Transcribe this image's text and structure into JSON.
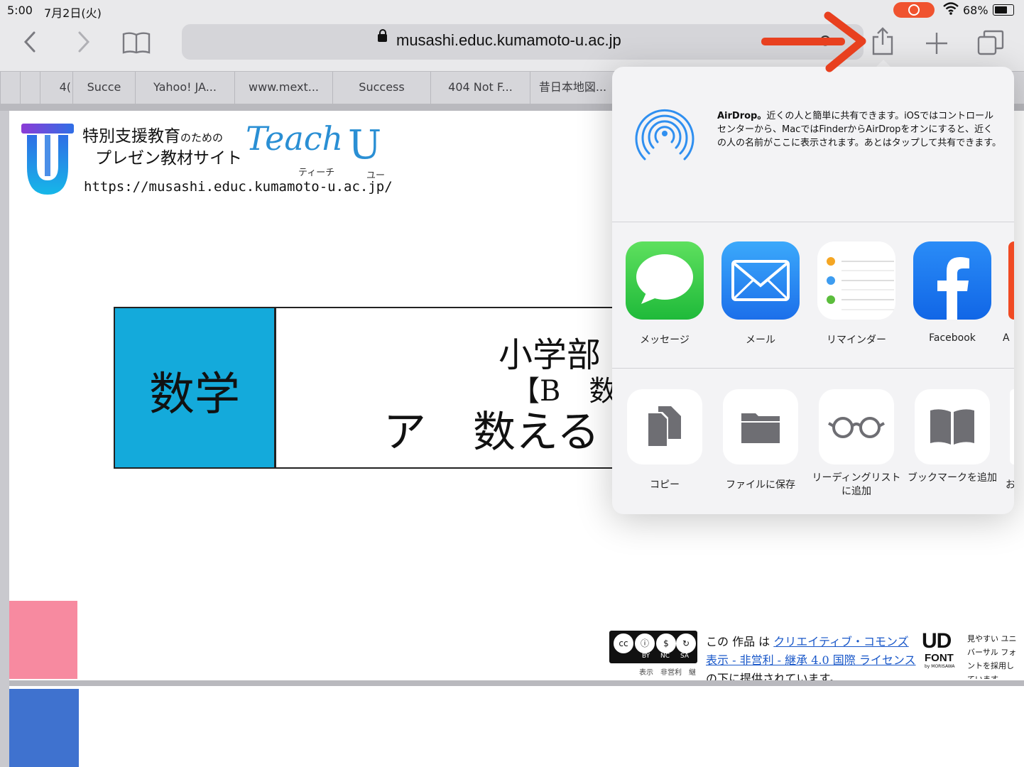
{
  "status": {
    "time": "5:00",
    "date": "7月2日(火)",
    "battery": "68%"
  },
  "toolbar": {
    "url": "musashi.educ.kumamoto-u.ac.jp"
  },
  "tabs": [
    {
      "label": "4("
    },
    {
      "label": "Succe"
    },
    {
      "label": "Yahoo! JA..."
    },
    {
      "label": "www.mext..."
    },
    {
      "label": "Success"
    },
    {
      "label": "404 Not F..."
    },
    {
      "label": "昔日本地図..."
    }
  ],
  "page": {
    "site_title_line1": "特別支援教育",
    "site_title_line1_small": "のための",
    "site_title_line2": "プレゼン教材サイト",
    "teach": "Teach",
    "teach_u": "U",
    "teach_kana": "ティーチ",
    "u_kana": "ユー",
    "site_url": "https://musashi.educ.kumamoto-u.ac.jp/",
    "subject": "数学",
    "title_line1": "小学部",
    "title_line2": "【B　数",
    "title_line3a": "ア",
    "title_line3b": "数える",
    "cc_labels": [
      "BY",
      "NC",
      "SA"
    ],
    "cc_sub": "表示　非営利　継",
    "license_line1_prefix": "この 作品 は ",
    "license_line1_link": "クリエイティブ・コモンズ",
    "license_line2": "表示 - 非営利 - 継承 4.0 国際 ライセンス",
    "license_line3": "の下に提供されています。",
    "ud_logo": "UD",
    "ud_font": "FONT",
    "ud_by": "by MORISAWA",
    "ud_text": "見やすい ユニバーサル フォントを採用しています"
  },
  "share": {
    "airdrop_title": "AirDrop。",
    "airdrop_text": "近くの人と簡単に共有できます。iOSではコントロールセンターから、MacではFinderからAirDropをオンにすると、近くの人の名前がここに表示されます。あとはタップして共有できます。",
    "apps": [
      {
        "label": "メッセージ"
      },
      {
        "label": "メール"
      },
      {
        "label": "リマインダー"
      },
      {
        "label": "Facebook"
      },
      {
        "label": "A"
      }
    ],
    "actions": [
      {
        "label": "コピー"
      },
      {
        "label": "ファイルに保存"
      },
      {
        "label": "リーディングリストに追加"
      },
      {
        "label": "ブックマークを追加"
      },
      {
        "label": "お"
      }
    ]
  },
  "colors": {
    "subject_bg": "#14aadb",
    "annotation_arrow": "#e8401f",
    "messages_green": "#2fc84b",
    "mail_blue": "#2a8cf5",
    "facebook_blue": "#1877f2"
  }
}
